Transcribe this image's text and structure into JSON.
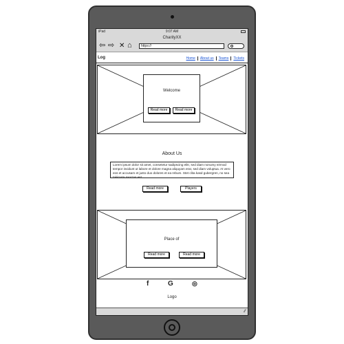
{
  "status": {
    "carrier": "iPad",
    "time": "9:07 AM"
  },
  "browser": {
    "title": "CharityXX",
    "url": "https://",
    "icons": [
      "back-arrow-icon",
      "forward-arrow-icon",
      "close-icon",
      "home-icon",
      "search-icon"
    ]
  },
  "site": {
    "logo_text": "Log",
    "nav": [
      "Home",
      "About us",
      "Teams",
      "Tickets"
    ]
  },
  "hero": {
    "title": "Welcome",
    "btn1": "Read more",
    "btn2": "Read more"
  },
  "about": {
    "title": "About Us",
    "text": "Lorem ipsum dolor sit amet, consetetur sadipscing elitr, sed diam nonumy eirmod tempor invidunt ut labore et dolore magna aliquyam erat, sed diam voluptua. At vero eos et accusam et justo duo dolores et ea rebum. Stet clita kasd gubergren, no sea takimata sanctus est.",
    "btn1": "Read more",
    "btn2": "Players"
  },
  "place": {
    "title": "Place of",
    "btn1": "Read more",
    "btn2": "Read more"
  },
  "footer": {
    "social": [
      "f",
      "G",
      "◎"
    ],
    "logo_text": "Logo"
  },
  "colors": {
    "device": "#5a5a5a",
    "bars": "#d9d9d9",
    "link": "#1a55d6"
  }
}
